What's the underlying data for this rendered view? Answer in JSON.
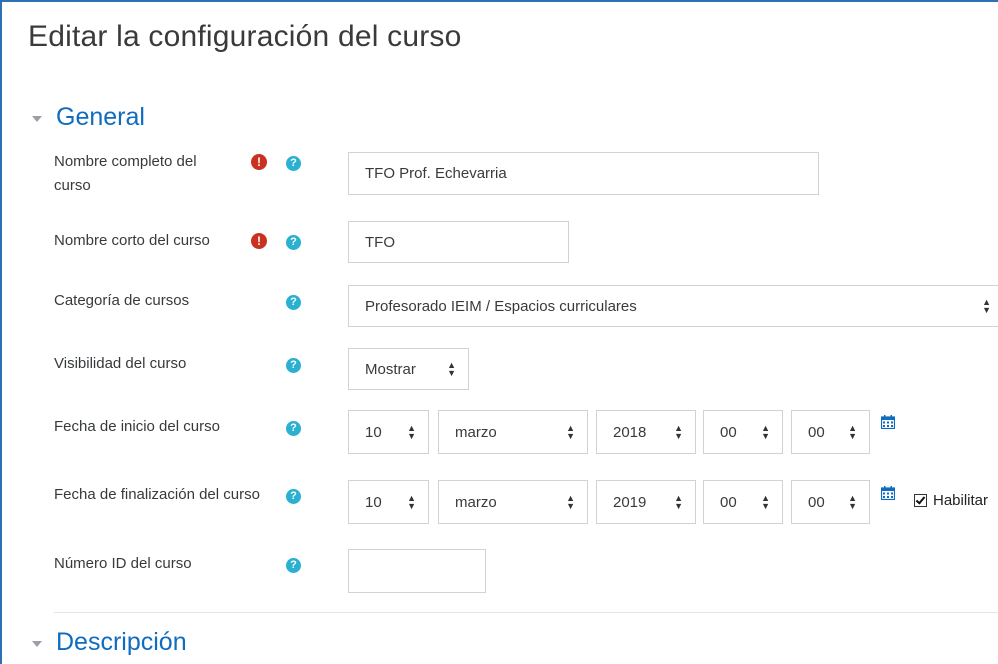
{
  "page_title": "Editar la configuración del curso",
  "sections": {
    "general": "General",
    "descripcion": "Descripción"
  },
  "fields": {
    "fullname": {
      "label": "Nombre completo del curso",
      "value": "TFO Prof. Echevarria",
      "required": true
    },
    "shortname": {
      "label": "Nombre corto del curso",
      "value": "TFO",
      "required": true
    },
    "category": {
      "label": "Categoría de cursos",
      "value": "Profesorado IEIM / Espacios curriculares"
    },
    "visibility": {
      "label": "Visibilidad del curso",
      "value": "Mostrar"
    },
    "startdate": {
      "label": "Fecha de inicio del curso",
      "day": "10",
      "month": "marzo",
      "year": "2018",
      "hour": "00",
      "minute": "00"
    },
    "enddate": {
      "label": "Fecha de finalización del curso",
      "day": "10",
      "month": "marzo",
      "year": "2019",
      "hour": "00",
      "minute": "00",
      "enable_label": "Habilitar",
      "enabled": true
    },
    "idnumber": {
      "label": "Número ID del curso",
      "value": ""
    }
  },
  "icons": {
    "required": "exclamation-circle-icon",
    "help": "question-circle-icon",
    "calendar": "calendar-icon",
    "section_toggle": "caret-down-icon"
  },
  "colors": {
    "accent": "#0f6cbf",
    "required_icon": "#ca3120",
    "help_icon": "#2ab0d0",
    "frame_border": "#2f6fb5"
  }
}
